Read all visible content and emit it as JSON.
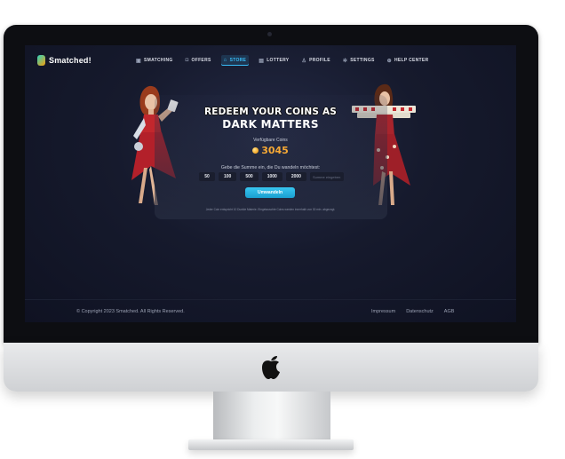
{
  "site": {
    "brand": "Smatched!"
  },
  "nav": {
    "items": [
      {
        "label": "Smatching",
        "icon": "dice-icon"
      },
      {
        "label": "Offers",
        "icon": "gift-icon"
      },
      {
        "label": "Store",
        "icon": "store-icon",
        "active": true
      },
      {
        "label": "Lottery",
        "icon": "ticket-icon"
      },
      {
        "label": "Profile",
        "icon": "user-icon"
      },
      {
        "label": "Settings",
        "icon": "gear-icon"
      },
      {
        "label": "Help Center",
        "icon": "help-icon"
      }
    ]
  },
  "redeem": {
    "title_line1": "REDEEM YOUR COINS AS",
    "title_line2": "DARK MATTERS",
    "coins_label": "Verfügbare Coins",
    "coins_value": "3045",
    "prompt": "Gebe die Summe ein, die Du wandeln möchtest:",
    "amounts": [
      "50",
      "100",
      "500",
      "1000",
      "2000"
    ],
    "custom_placeholder": "Summe eingeben",
    "button_label": "Umwandeln",
    "disclaimer": "Jeder Coin entspricht 10 Dunkle Materie. Eingetauschte Coins werden innerhalb von 30 min. abgezogt."
  },
  "footer": {
    "copyright": "© Copyright 2023 Smatched. All Rights Reserved.",
    "links": [
      "Impressum",
      "Datenschutz",
      "AGB"
    ]
  },
  "colors": {
    "accent": "#38bdf8",
    "coin": "#f7a935",
    "background": "#161a2d",
    "button": "#1a9fd0"
  }
}
